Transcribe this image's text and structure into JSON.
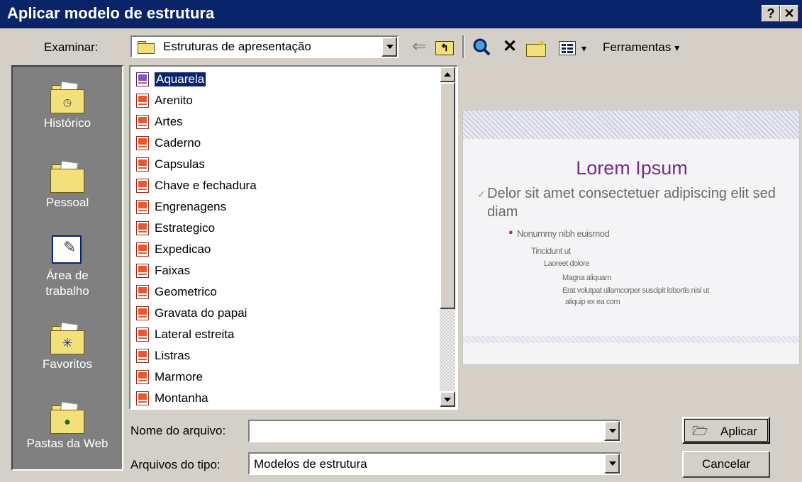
{
  "window": {
    "title": "Aplicar modelo de estrutura",
    "help_btn": "?",
    "close_btn": "✕"
  },
  "toolbar": {
    "look_in_label": "Examinar:",
    "look_in_value": "Estruturas de apresentação",
    "tools_label": "Ferramentas",
    "tools_arrow": "▾"
  },
  "places": [
    {
      "label": "Histórico",
      "icon": "history-folder-icon"
    },
    {
      "label": "Pessoal",
      "icon": "personal-folder-icon"
    },
    {
      "label": "Área de trabalho",
      "icon": "desktop-icon"
    },
    {
      "label": "Favoritos",
      "icon": "favorites-folder-icon"
    },
    {
      "label": "Pastas da Web",
      "icon": "web-folders-icon"
    }
  ],
  "files": [
    "Aquarela",
    "Arenito",
    "Artes",
    "Caderno",
    "Capsulas",
    "Chave e fechadura",
    "Engrenagens",
    "Estrategico",
    "Expedicao",
    "Faixas",
    "Geometrico",
    "Gravata do papai",
    "Lateral estreita",
    "Listras",
    "Marmore",
    "Montanha"
  ],
  "selected_file": "Aquarela",
  "preview": {
    "title": "Lorem Ipsum",
    "level1": "Delor sit amet consectetuer adipiscing elit sed diam",
    "level2": "Nonummy nibh euismod",
    "level3": "Tincidunt ut",
    "level4": "Laoreet dolore",
    "level5a": "Magna aliquam",
    "level5b": "Erat volutpat ullamcorper suscipit lobortis nisl ut",
    "level5c": "aliquip ex ea com"
  },
  "form": {
    "filename_label": "Nome do arquivo:",
    "filename_value": "",
    "filetype_label": "Arquivos do tipo:",
    "filetype_value": "Modelos de estrutura"
  },
  "buttons": {
    "apply": "Aplicar",
    "cancel": "Cancelar"
  }
}
